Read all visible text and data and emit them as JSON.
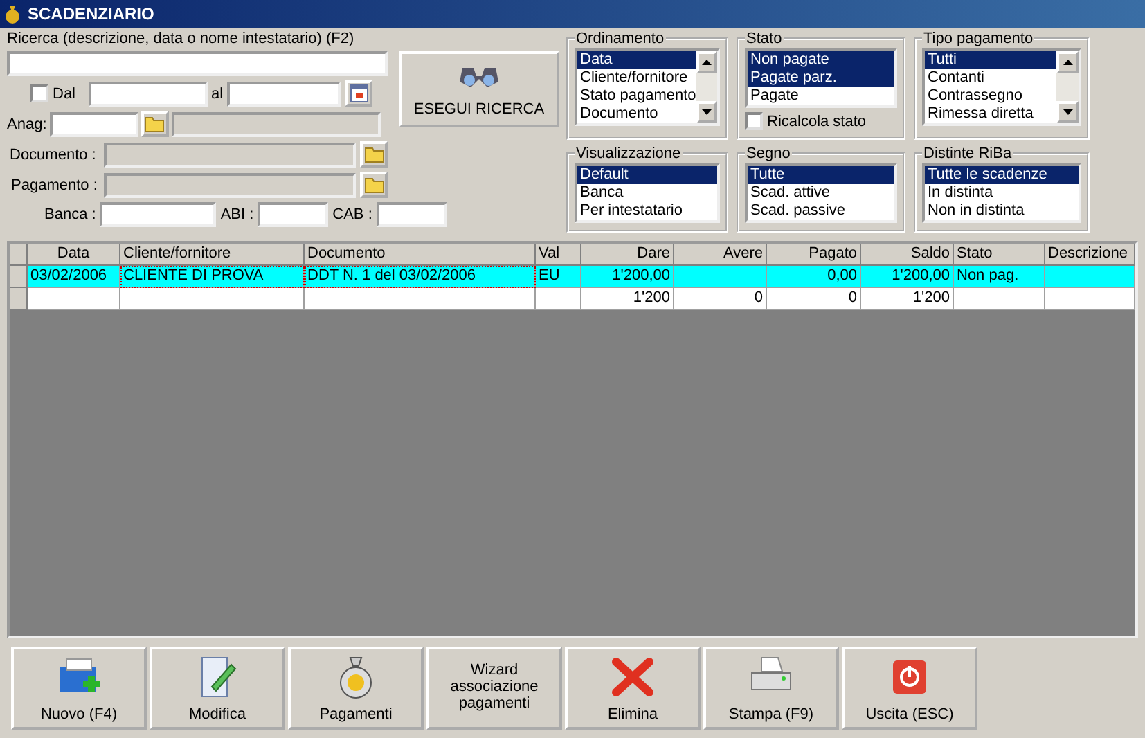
{
  "window": {
    "title": "SCADENZIARIO"
  },
  "search": {
    "label": "Ricerca (descrizione, data o nome intestatario) (F2)",
    "date_checkbox": {
      "label": "Dal",
      "checked": false
    },
    "to_label": "al",
    "anag_label": "Anag:",
    "documento_label": "Documento :",
    "pagamento_label": "Pagamento :",
    "banca_label": "Banca :",
    "abi_label": "ABI :",
    "cab_label": "CAB :",
    "button": "ESEGUI RICERCA"
  },
  "filters": [
    {
      "title": "Ordinamento",
      "kind": "scroll",
      "items": [
        {
          "label": "Data",
          "selected": true
        },
        {
          "label": "Cliente/fornitore",
          "selected": false
        },
        {
          "label": "Stato pagamento",
          "selected": false
        },
        {
          "label": "Documento",
          "selected": false
        }
      ]
    },
    {
      "title": "Stato",
      "kind": "check",
      "checkbox": {
        "label": "Ricalcola stato",
        "checked": false
      },
      "items": [
        {
          "label": "Non pagate",
          "selected": true
        },
        {
          "label": "Pagate parz.",
          "selected": true
        },
        {
          "label": "Pagate",
          "selected": false
        }
      ]
    },
    {
      "title": "Tipo pagamento",
      "kind": "scroll",
      "items": [
        {
          "label": "Tutti",
          "selected": true
        },
        {
          "label": "Contanti",
          "selected": false
        },
        {
          "label": "Contrassegno",
          "selected": false
        },
        {
          "label": "Rimessa diretta",
          "selected": false
        }
      ]
    },
    {
      "title": "Visualizzazione",
      "kind": "plain",
      "items": [
        {
          "label": "Default",
          "selected": true
        },
        {
          "label": "Banca",
          "selected": false
        },
        {
          "label": "Per intestatario",
          "selected": false
        }
      ]
    },
    {
      "title": "Segno",
      "kind": "plain",
      "items": [
        {
          "label": "Tutte",
          "selected": true
        },
        {
          "label": "Scad. attive",
          "selected": false
        },
        {
          "label": "Scad. passive",
          "selected": false
        }
      ]
    },
    {
      "title": "Distinte RiBa",
      "kind": "plain",
      "items": [
        {
          "label": "Tutte le scadenze",
          "selected": true
        },
        {
          "label": "In distinta",
          "selected": false
        },
        {
          "label": "Non in distinta",
          "selected": false
        }
      ]
    }
  ],
  "table": {
    "columns": [
      "Data",
      "Cliente/fornitore",
      "Documento",
      "Val",
      "Dare",
      "Avere",
      "Pagato",
      "Saldo",
      "Stato",
      "Descrizione"
    ],
    "rows": [
      {
        "selected": true,
        "cells": [
          "03/02/2006",
          "CLIENTE DI PROVA",
          "DDT N. 1 del 03/02/2006",
          "EU",
          "1'200,00",
          "",
          "0,00",
          "1'200,00",
          "Non pag.",
          ""
        ]
      },
      {
        "selected": false,
        "cells": [
          "",
          "",
          "",
          "",
          "1'200",
          "0",
          "0",
          "1'200",
          "",
          ""
        ]
      }
    ]
  },
  "buttons": [
    {
      "kind": "new",
      "label": "Nuovo (F4)"
    },
    {
      "kind": "edit",
      "label": "Modifica"
    },
    {
      "kind": "money",
      "label": "Pagamenti"
    },
    {
      "kind": "text",
      "label": "Wizard associazione pagamenti"
    },
    {
      "kind": "delete",
      "label": "Elimina"
    },
    {
      "kind": "print",
      "label": "Stampa (F9)"
    },
    {
      "kind": "exit",
      "label": "Uscita (ESC)"
    }
  ]
}
